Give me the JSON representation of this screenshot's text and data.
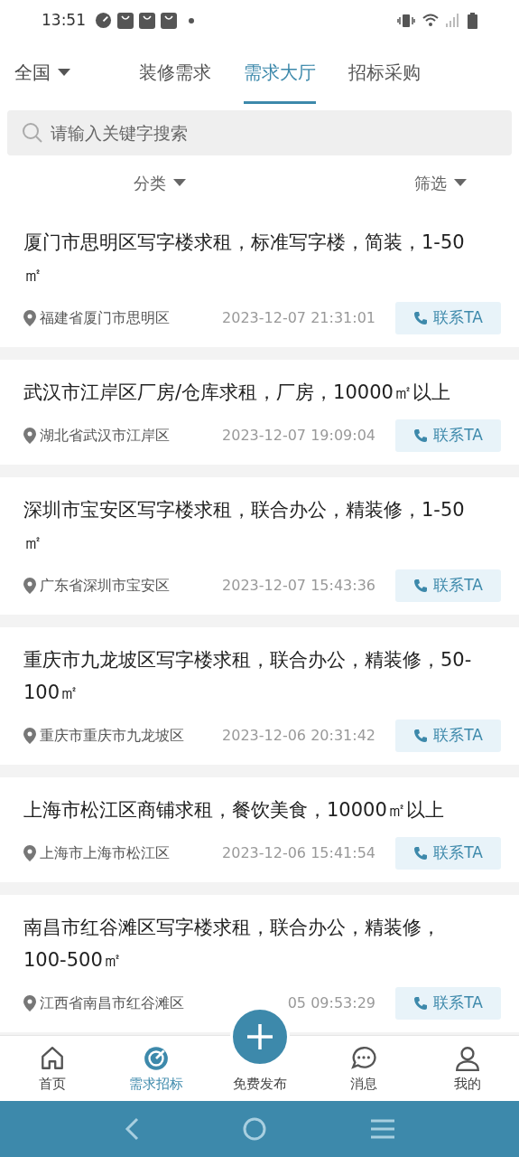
{
  "status_bar": {
    "time": "13:51"
  },
  "header": {
    "region": "全国",
    "tabs": [
      {
        "label": "装修需求",
        "selected": false
      },
      {
        "label": "需求大厅",
        "selected": true
      },
      {
        "label": "招标采购",
        "selected": false
      }
    ]
  },
  "search": {
    "placeholder": "请输入关键字搜索"
  },
  "filters": [
    "分类",
    "筛选"
  ],
  "listings": [
    {
      "title": "厦门市思明区写字楼求租，标准写字楼，简装，1-50㎡",
      "location": "福建省厦门市思明区",
      "time": "2023-12-07 21:31:01",
      "action": "联系TA"
    },
    {
      "title": "武汉市江岸区厂房/仓库求租，厂房，10000㎡以上",
      "location": "湖北省武汉市江岸区",
      "time": "2023-12-07 19:09:04",
      "action": "联系TA"
    },
    {
      "title": "深圳市宝安区写字楼求租，联合办公，精装修，1-50㎡",
      "location": "广东省深圳市宝安区",
      "time": "2023-12-07 15:43:36",
      "action": "联系TA"
    },
    {
      "title": "重庆市九龙坡区写字楼求租，联合办公，精装修，50-100㎡",
      "location": "重庆市重庆市九龙坡区",
      "time": "2023-12-06 20:31:42",
      "action": "联系TA"
    },
    {
      "title": "上海市松江区商铺求租，餐饮美食，10000㎡以上",
      "location": "上海市上海市松江区",
      "time": "2023-12-06 15:41:54",
      "action": "联系TA"
    },
    {
      "title": "南昌市红谷滩区写字楼求租，联合办公，精装修，100-500㎡",
      "location": "江西省南昌市红谷滩区",
      "time": "05 09:53:29",
      "action": "联系TA"
    }
  ],
  "bottom_nav": [
    {
      "label": "首页",
      "selected": false
    },
    {
      "label": "需求招标",
      "selected": true
    },
    {
      "label": "免费发布",
      "selected": false
    },
    {
      "label": "消息",
      "selected": false
    },
    {
      "label": "我的",
      "selected": false
    }
  ]
}
